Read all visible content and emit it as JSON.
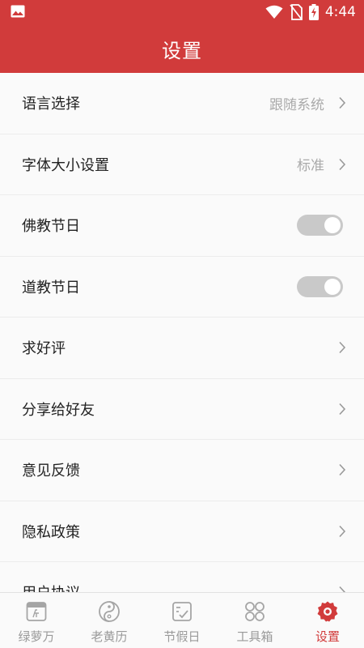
{
  "status_bar": {
    "time": "4:44"
  },
  "header": {
    "title": "设置"
  },
  "settings": [
    {
      "label": "语言选择",
      "value": "跟随系统",
      "control": "chevron"
    },
    {
      "label": "字体大小设置",
      "value": "标准",
      "control": "chevron"
    },
    {
      "label": "佛教节日",
      "value": "",
      "control": "toggle"
    },
    {
      "label": "道教节日",
      "value": "",
      "control": "toggle"
    },
    {
      "label": "求好评",
      "value": "",
      "control": "chevron"
    },
    {
      "label": "分享给好友",
      "value": "",
      "control": "chevron"
    },
    {
      "label": "意见反馈",
      "value": "",
      "control": "chevron"
    },
    {
      "label": "隐私政策",
      "value": "",
      "control": "chevron"
    },
    {
      "label": "用户协议",
      "value": "",
      "control": "chevron"
    }
  ],
  "tabs": [
    {
      "label": "绿萝万",
      "icon": "calendar-icon",
      "active": false
    },
    {
      "label": "老黄历",
      "icon": "yin-yang-icon",
      "active": false
    },
    {
      "label": "节假日",
      "icon": "checklist-icon",
      "active": false
    },
    {
      "label": "工具箱",
      "icon": "grid-icon",
      "active": false
    },
    {
      "label": "设置",
      "icon": "settings-icon",
      "active": true
    }
  ],
  "colors": {
    "brand": "#d13b3b",
    "inactive": "#9a9a9a",
    "toggle_off": "#c9c9c9"
  }
}
